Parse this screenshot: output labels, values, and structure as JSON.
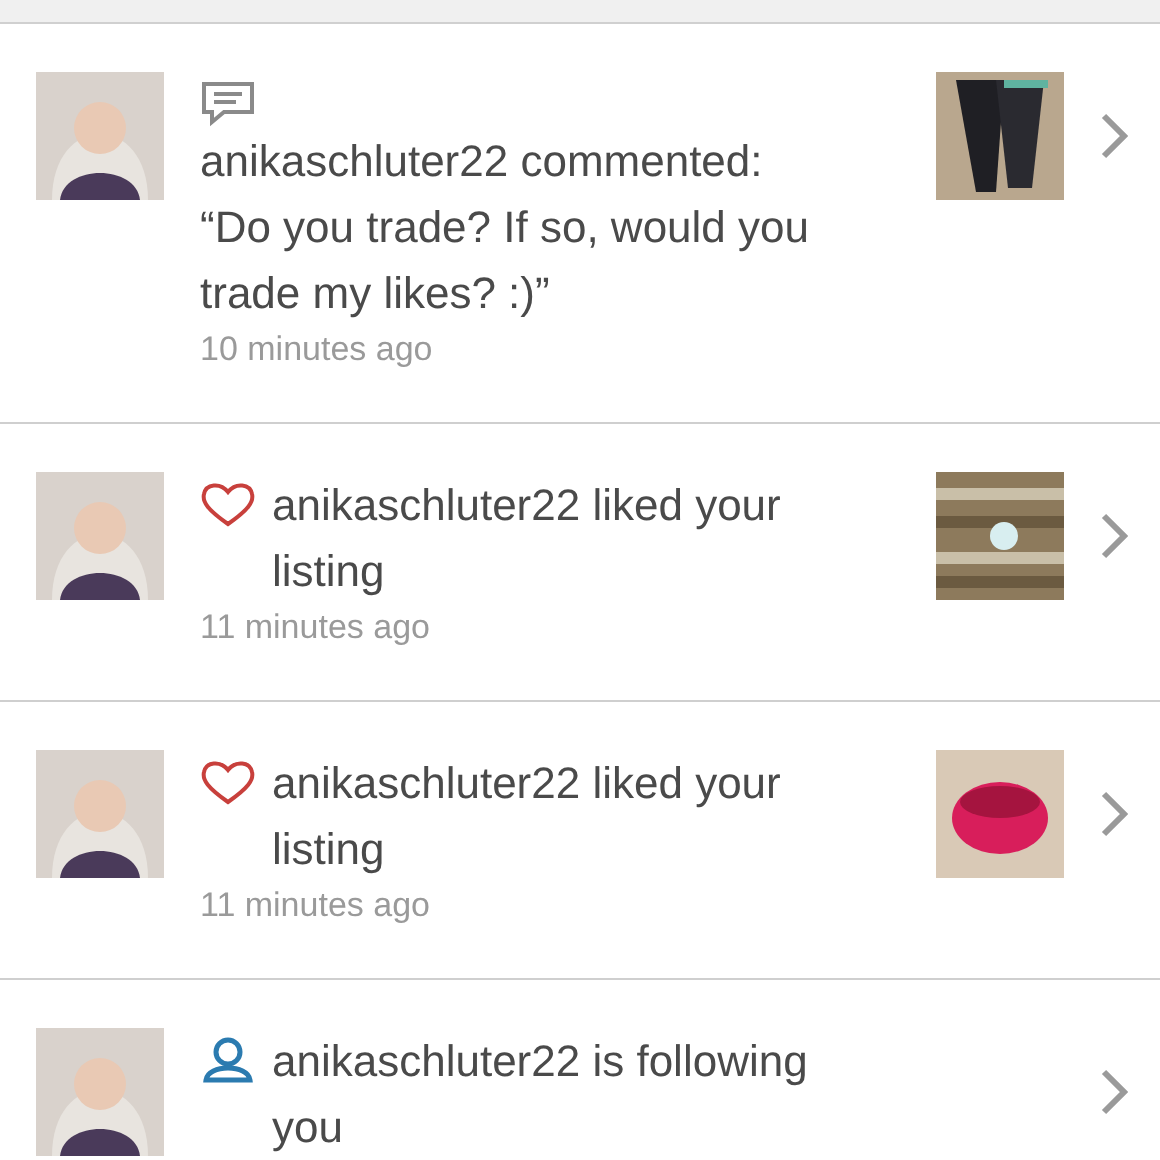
{
  "notifications": [
    {
      "kind": "comment",
      "message": "anikaschluter22 commented:",
      "comment": "“Do you trade? If so, would you trade my likes? :)”",
      "time": "10 minutes ago"
    },
    {
      "kind": "like",
      "message": "anikaschluter22 liked your listing",
      "time": "11 minutes ago"
    },
    {
      "kind": "like",
      "message": "anikaschluter22 liked your listing",
      "time": "11 minutes ago"
    },
    {
      "kind": "follow",
      "message": "anikaschluter22 is following you"
    }
  ]
}
